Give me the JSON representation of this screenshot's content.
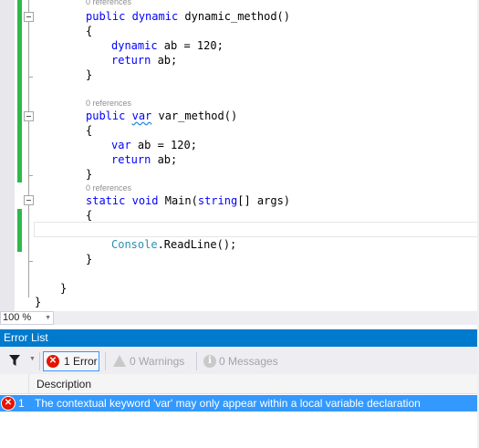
{
  "editor": {
    "codelens_label": "0 references",
    "lines": {
      "l1_kw1": "public",
      "l1_kw2": "dynamic",
      "l1_rest": " dynamic_method()",
      "l2": "{",
      "l3_kw": "dynamic",
      "l3_rest": " ab = 120;",
      "l4_kw": "return",
      "l4_rest": " ab;",
      "l5": "}",
      "l6_kw": "public",
      "l6_var": "var",
      "l6_rest": " var_method()",
      "l7": "{",
      "l8_kw": "var",
      "l8_rest": " ab = 120;",
      "l9_kw": "return",
      "l9_rest": " ab;",
      "l10": "}",
      "l11_kw1": "static",
      "l11_kw2": "void",
      "l11_mid": " Main(",
      "l11_kw3": "string",
      "l11_rest": "[] args)",
      "l12": "{",
      "l13_type": "Console",
      "l13_rest": ".ReadLine();",
      "l14": "}",
      "l15": "}",
      "l16": "}"
    }
  },
  "zoom": {
    "value": "100 %",
    "arrow": "▼"
  },
  "error_list": {
    "title": "Error List",
    "filter_icon": "funnel-icon",
    "errors_label": "1 Error",
    "warnings_label": "0 Warnings",
    "messages_label": "0 Messages",
    "column_description": "Description",
    "rows": [
      {
        "num": "1",
        "description": "The contextual keyword 'var' may only appear within a local variable declaration"
      }
    ]
  },
  "colors": {
    "accent": "#007acc",
    "selection": "#3399ff",
    "error": "#e51400",
    "change_bar": "#2eb84b",
    "keyword": "#0000ff",
    "type": "#2b91af"
  }
}
